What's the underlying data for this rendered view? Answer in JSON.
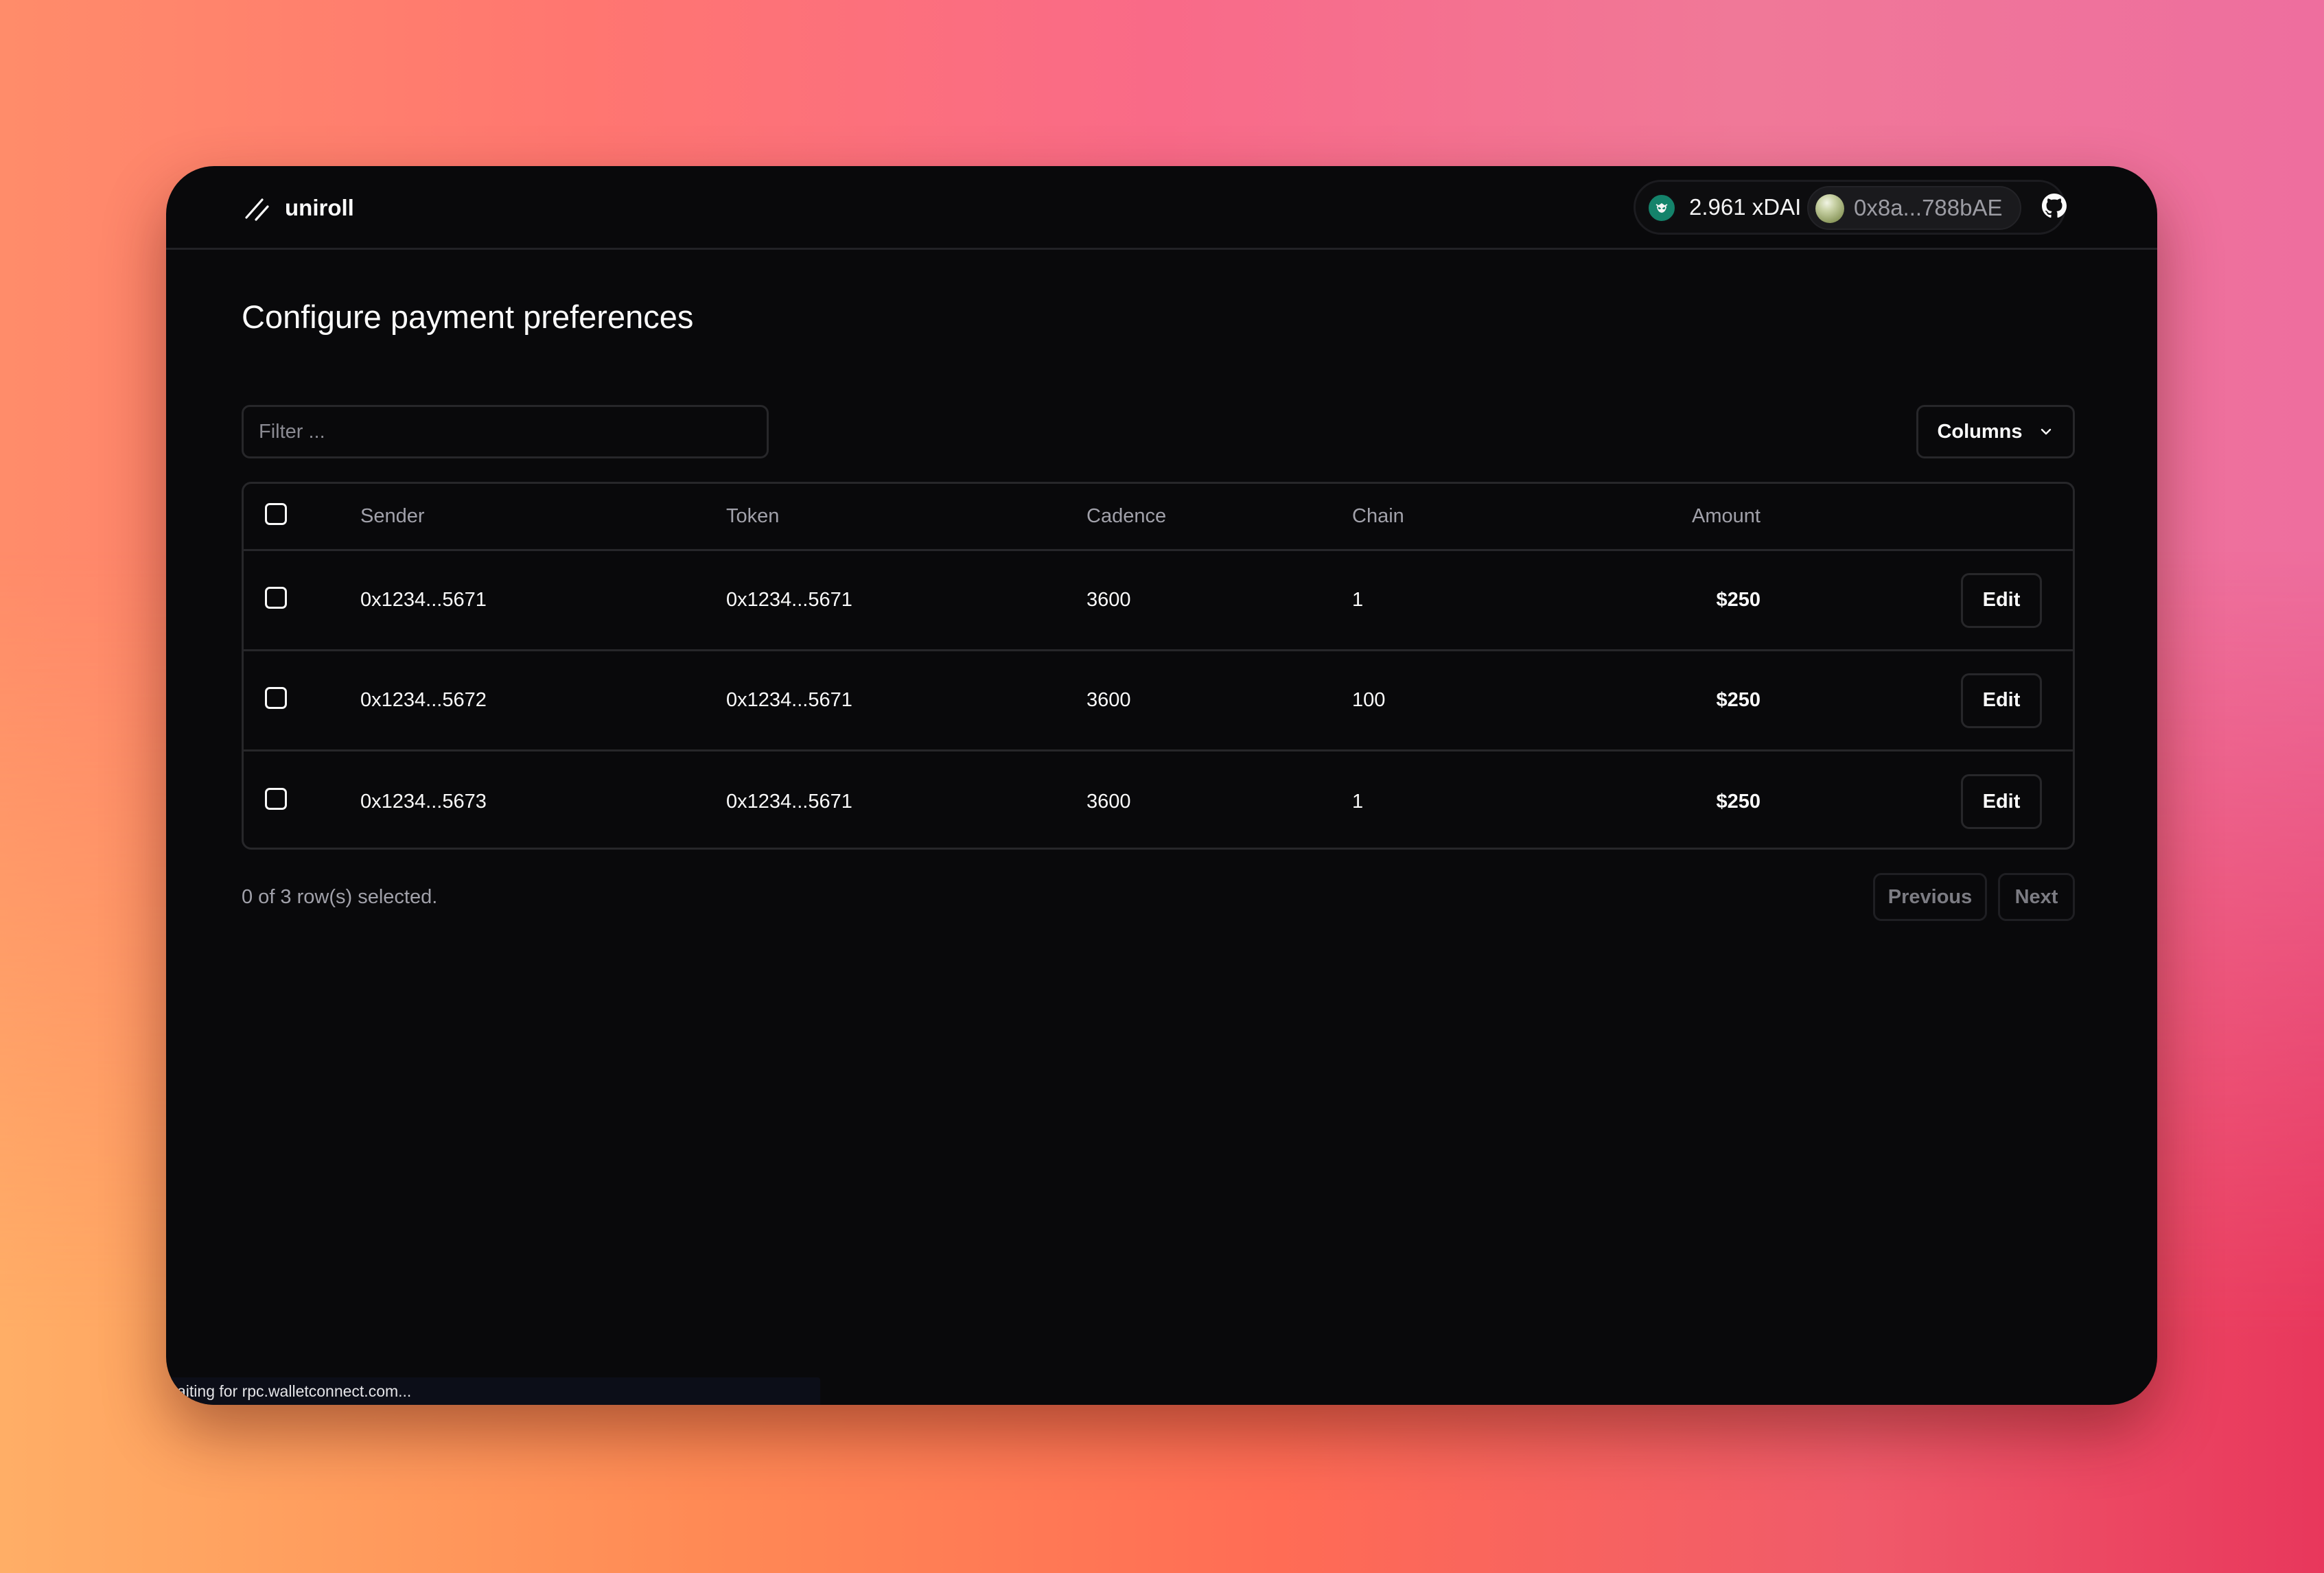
{
  "app": {
    "name": "uniroll",
    "logo_icon": "slash-slash-logo-icon"
  },
  "header": {
    "wallet": {
      "chain_icon": "gnosis-owl-icon",
      "chain_color": "#14836b",
      "balance": "2.961 xDAI",
      "address": "0x8a...788bAE",
      "avatar_icon": "wallet-avatar-orb"
    },
    "github_icon": "github-icon"
  },
  "main": {
    "title": "Configure payment preferences",
    "filter": {
      "placeholder": "Filter ...",
      "value": ""
    },
    "columns_button": {
      "label": "Columns",
      "icon": "chevron-down-icon"
    },
    "table": {
      "columns": [
        "Sender",
        "Token",
        "Cadence",
        "Chain",
        "Amount"
      ],
      "rows": [
        {
          "selected": false,
          "sender": "0x1234...5671",
          "token": "0x1234...5671",
          "cadence": "3600",
          "chain": "1",
          "amount": "$250",
          "action": "Edit"
        },
        {
          "selected": false,
          "sender": "0x1234...5672",
          "token": "0x1234...5671",
          "cadence": "3600",
          "chain": "100",
          "amount": "$250",
          "action": "Edit"
        },
        {
          "selected": false,
          "sender": "0x1234...5673",
          "token": "0x1234...5671",
          "cadence": "3600",
          "chain": "1",
          "amount": "$250",
          "action": "Edit"
        }
      ]
    },
    "footer": {
      "selection_text": "0 of 3 row(s) selected.",
      "previous_label": "Previous",
      "next_label": "Next"
    }
  },
  "status_bar": {
    "text": "aiting for rpc.walletconnect.com..."
  },
  "colors": {
    "background": "#09090b",
    "border": "#27272a",
    "text": "#fafafa",
    "muted_text": "#a1a1aa"
  }
}
